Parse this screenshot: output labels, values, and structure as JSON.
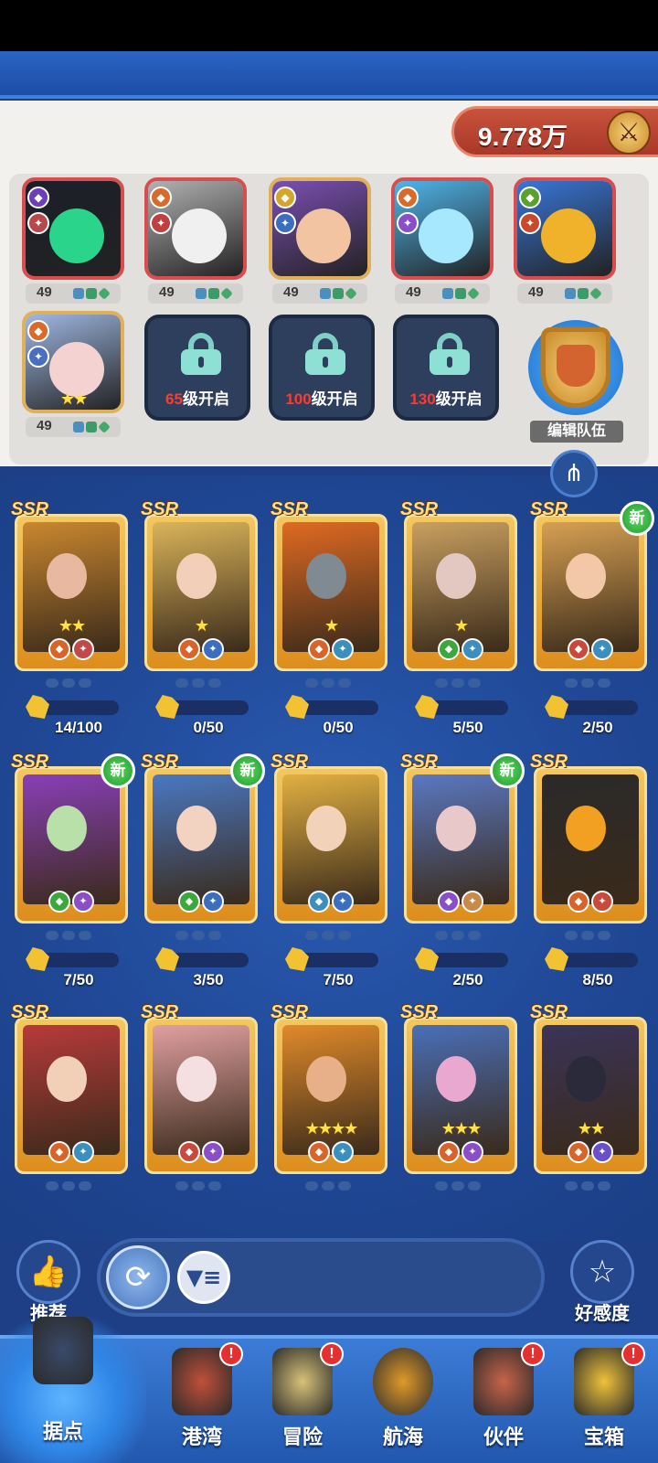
{
  "power": {
    "value": "9.778万",
    "icon": "crossed-swords-icon"
  },
  "team": {
    "slots": [
      {
        "level": "49",
        "cls1": "#6a3fb8",
        "cls2": "#b64a4a",
        "bg": "#1c1f2a",
        "accent": "#2bd48b"
      },
      {
        "level": "49",
        "cls1": "#d86a2a",
        "cls2": "#c04040",
        "bg": "#b2b2b2",
        "accent": "#f0f0f0"
      },
      {
        "level": "49",
        "cls1": "#d4a52a",
        "cls2": "#3a6fbf",
        "bg": "#7a4fb2",
        "accent": "#f2c4a2"
      },
      {
        "level": "49",
        "cls1": "#d86a2a",
        "cls2": "#8a4fc8",
        "bg": "#4fb5ea",
        "accent": "#a8e8ff"
      },
      {
        "level": "49",
        "cls1": "#5aa02a",
        "cls2": "#c84a2a",
        "bg": "#3876d8",
        "accent": "#f0b22a"
      },
      {
        "level": "49",
        "cls1": "#d86a2a",
        "cls2": "#4a6fbf",
        "bg": "#9fb8e2",
        "accent": "#f4d2d2",
        "stars": "★★"
      }
    ],
    "locks": [
      {
        "level": "65",
        "suffix": "级开启"
      },
      {
        "level": "100",
        "suffix": "级开启"
      },
      {
        "level": "130",
        "suffix": "级开启"
      }
    ],
    "edit_label": "编辑队伍"
  },
  "cards": [
    {
      "rarity": "SSR",
      "stars": "★★",
      "badge1": "#d8642a",
      "badge2": "#c04a4a",
      "art": "#c9872f",
      "face": "#e8b8a0",
      "shards": "14/100",
      "progress": 0.14,
      "new": ""
    },
    {
      "rarity": "SSR",
      "stars": "★",
      "badge1": "#d8642a",
      "badge2": "#3a6fbf",
      "art": "#d9b45a",
      "face": "#f2cfb8",
      "shards": "0/50",
      "progress": 0,
      "new": ""
    },
    {
      "rarity": "SSR",
      "stars": "★",
      "badge1": "#d8642a",
      "badge2": "#3a8fbf",
      "art": "#e06a22",
      "face": "#7f8a92",
      "shards": "0/50",
      "progress": 0,
      "new": ""
    },
    {
      "rarity": "SSR",
      "stars": "★",
      "badge1": "#3aa83a",
      "badge2": "#3a8fbf",
      "art": "#c8a060",
      "face": "#e2c8c0",
      "shards": "5/50",
      "progress": 0.1,
      "new": ""
    },
    {
      "rarity": "SSR",
      "stars": "",
      "badge1": "#c84a3a",
      "badge2": "#3a8fbf",
      "art": "#d6a052",
      "face": "#f2c8a8",
      "shards": "2/50",
      "progress": 0.04,
      "new": "新"
    },
    {
      "rarity": "SSR",
      "stars": "",
      "badge1": "#3aa83a",
      "badge2": "#8a4fc8",
      "art": "#8a3fb8",
      "face": "#b8e0a8",
      "shards": "7/50",
      "progress": 0.14,
      "new": "新"
    },
    {
      "rarity": "SSR",
      "stars": "",
      "badge1": "#3aa83a",
      "badge2": "#3a6fbf",
      "art": "#4a78c2",
      "face": "#f2d2c0",
      "shards": "3/50",
      "progress": 0.06,
      "new": "新"
    },
    {
      "rarity": "SSR",
      "stars": "",
      "badge1": "#3a8fbf",
      "badge2": "#3a6fbf",
      "art": "#e2b042",
      "face": "#f2d2b8",
      "shards": "7/50",
      "progress": 0.14,
      "new": ""
    },
    {
      "rarity": "SSR",
      "stars": "",
      "badge1": "#8a4fc8",
      "badge2": "#c88a4a",
      "art": "#5a78c2",
      "face": "#e8c8c8",
      "shards": "2/50",
      "progress": 0.04,
      "new": "新"
    },
    {
      "rarity": "SSR",
      "stars": "",
      "badge1": "#d8642a",
      "badge2": "#c84a3a",
      "art": "#2a2a2a",
      "face": "#f2a022",
      "shards": "8/50",
      "progress": 0.16,
      "new": ""
    },
    {
      "rarity": "SSR",
      "stars": "",
      "badge1": "#d8642a",
      "badge2": "#3a8fbf",
      "art": "#b83a3a",
      "face": "#f2d0b8",
      "shards": "",
      "progress": 0,
      "new": ""
    },
    {
      "rarity": "SSR",
      "stars": "",
      "badge1": "#c84a3a",
      "badge2": "#8a4fc8",
      "art": "#e0a0a0",
      "face": "#f4e0e0",
      "shards": "",
      "progress": 0,
      "new": ""
    },
    {
      "rarity": "SSR",
      "stars": "★★★★",
      "badge1": "#d8642a",
      "badge2": "#3a8fbf",
      "art": "#e08a2a",
      "face": "#e8b088",
      "shards": "",
      "progress": 0,
      "new": ""
    },
    {
      "rarity": "SSR",
      "stars": "★★★",
      "badge1": "#d8642a",
      "badge2": "#8a4fc8",
      "art": "#4a6fb8",
      "face": "#e8a8d0",
      "shards": "",
      "progress": 0,
      "new": ""
    },
    {
      "rarity": "SSR",
      "stars": "★★",
      "badge1": "#d8642a",
      "badge2": "#6a4fc8",
      "art": "#3a3458",
      "face": "#2a2a3a",
      "shards": "",
      "progress": 0,
      "new": ""
    }
  ],
  "side": {
    "recommend": "推荐",
    "favor": "好感度"
  },
  "nav": [
    {
      "label": "据点",
      "icon": "fortress-icon",
      "alert": "",
      "color": "#3a4a6a"
    },
    {
      "label": "港湾",
      "icon": "harbor-hut-icon",
      "alert": "!",
      "color": "#c0503a"
    },
    {
      "label": "冒险",
      "icon": "treasure-map-icon",
      "alert": "!",
      "color": "#d8c278"
    },
    {
      "label": "航海",
      "icon": "ship-wheel-icon",
      "alert": "",
      "color": "#e09a2a"
    },
    {
      "label": "伙伴",
      "icon": "pirate-face-icon",
      "alert": "!",
      "color": "#c8644a"
    },
    {
      "label": "宝箱",
      "icon": "treasure-chest-icon",
      "alert": "!",
      "color": "#f0c23a"
    }
  ]
}
